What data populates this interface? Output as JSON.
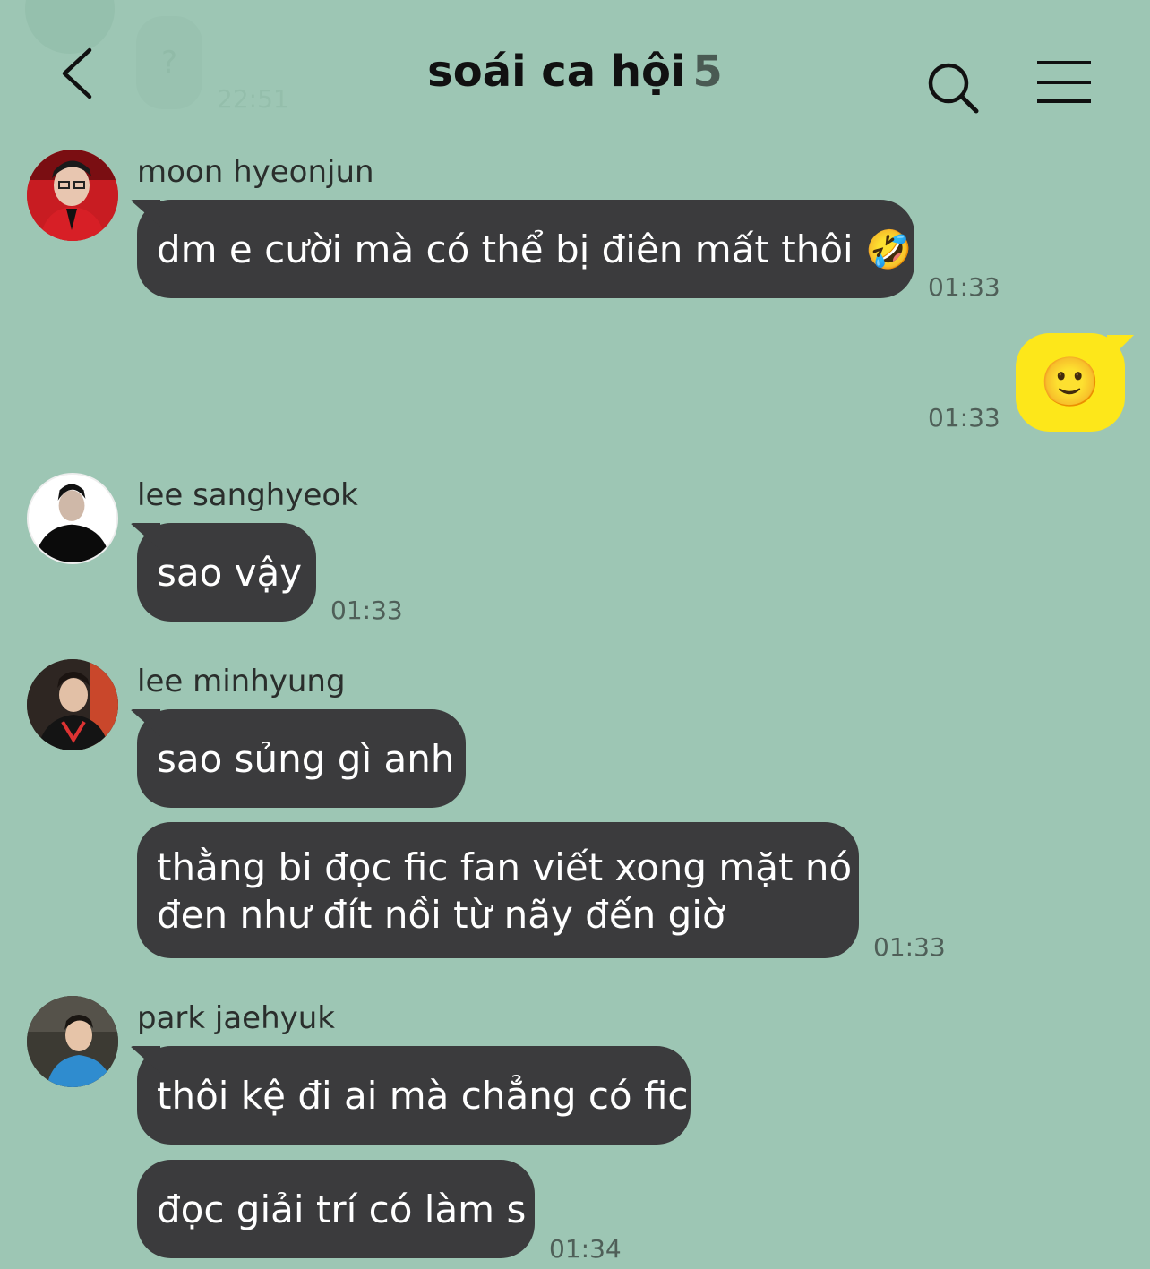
{
  "header": {
    "title": "soái ca hội",
    "member_count": "5"
  },
  "ghost": {
    "bubble_text": "?",
    "time": "22:51"
  },
  "messages": [
    {
      "sender": "moon hyeonjun",
      "text": "dm e cười mà có thể bị điên mất thôi 🤣",
      "time": "01:33"
    },
    {
      "sender": "me",
      "emoji": "🙂",
      "time": "01:33"
    },
    {
      "sender": "lee sanghyeok",
      "text": "sao vậy",
      "time": "01:33"
    },
    {
      "sender": "lee minhyung",
      "text": "sao sủng gì anh"
    },
    {
      "text_line1": "thằng bi đọc fic fan viết xong mặt nó",
      "text_line2": "đen như đít nồi từ nãy đến giờ",
      "time": "01:33"
    },
    {
      "sender": "park jaehyuk",
      "text": "thôi kệ đi ai mà chẳng có fic"
    },
    {
      "text": "đọc giải trí có làm s",
      "time": "01:34"
    }
  ],
  "colors": {
    "background": "#9dc6b4",
    "bubble": "#3b3b3d",
    "my_bubble": "#fde71a"
  },
  "icons": [
    "back-icon",
    "search-icon",
    "menu-icon"
  ]
}
